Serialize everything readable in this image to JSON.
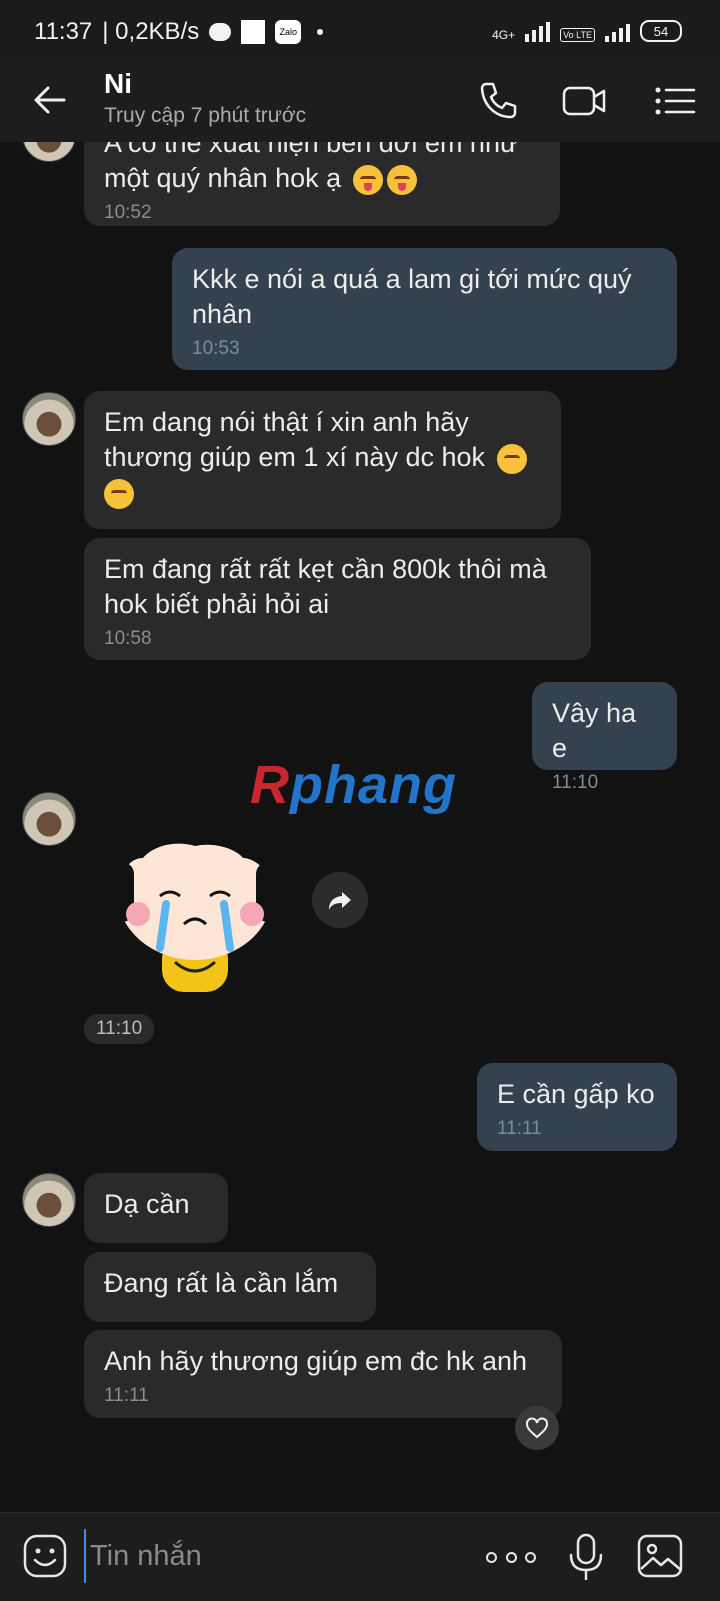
{
  "status_bar": {
    "time": "11:37",
    "network_speed": "| 0,2KB/s",
    "zalo_badge": "Zalo",
    "network_4g": "4G+",
    "volte_label": "Vo LTE",
    "battery": "54"
  },
  "header": {
    "contact_name": "Ni",
    "last_seen": "Truy cập 7 phút trước"
  },
  "messages": [
    {
      "dir": "in",
      "text": "A có thể xuất hiện bên đời em như một quý nhân hok ạ",
      "emojis": "😝😝",
      "time": "10:52"
    },
    {
      "dir": "out",
      "text": "Kkk e nói a quá a lam gi tới mức quý nhân",
      "time": "10:53"
    },
    {
      "dir": "in",
      "text": "Em dang nói thật í xin anh hãy thương giúp em 1 xí này dc hok",
      "emojis": "😣😣"
    },
    {
      "dir": "in",
      "text": "Em đang rất rất kẹt cần 800k thôi mà hok biết phải hỏi ai",
      "time": "10:58"
    },
    {
      "dir": "out",
      "text": "Vây ha e",
      "time": "11:10"
    },
    {
      "dir": "in",
      "type": "sticker",
      "time": "11:10"
    },
    {
      "dir": "out",
      "text": "E cần gấp ko",
      "time": "11:11"
    },
    {
      "dir": "in",
      "text": "Dạ cần"
    },
    {
      "dir": "in",
      "text": "Đang rất là cần lắm"
    },
    {
      "dir": "in",
      "text": "Anh hãy thương giúp em đc hk anh",
      "time": "11:11"
    }
  ],
  "watermark": {
    "first": "R",
    "rest": "phang"
  },
  "composer": {
    "placeholder": "Tin nhắn"
  },
  "colors": {
    "background": "#121212",
    "incoming_bubble": "#2a2a2a",
    "outgoing_bubble": "#34414e",
    "cursor": "#3b8ff0"
  },
  "icons": [
    "back-arrow-icon",
    "phone-icon",
    "video-call-icon",
    "list-menu-icon",
    "forward-icon",
    "heart-icon",
    "emoji-icon",
    "more-dots-icon",
    "microphone-icon",
    "image-icon"
  ]
}
